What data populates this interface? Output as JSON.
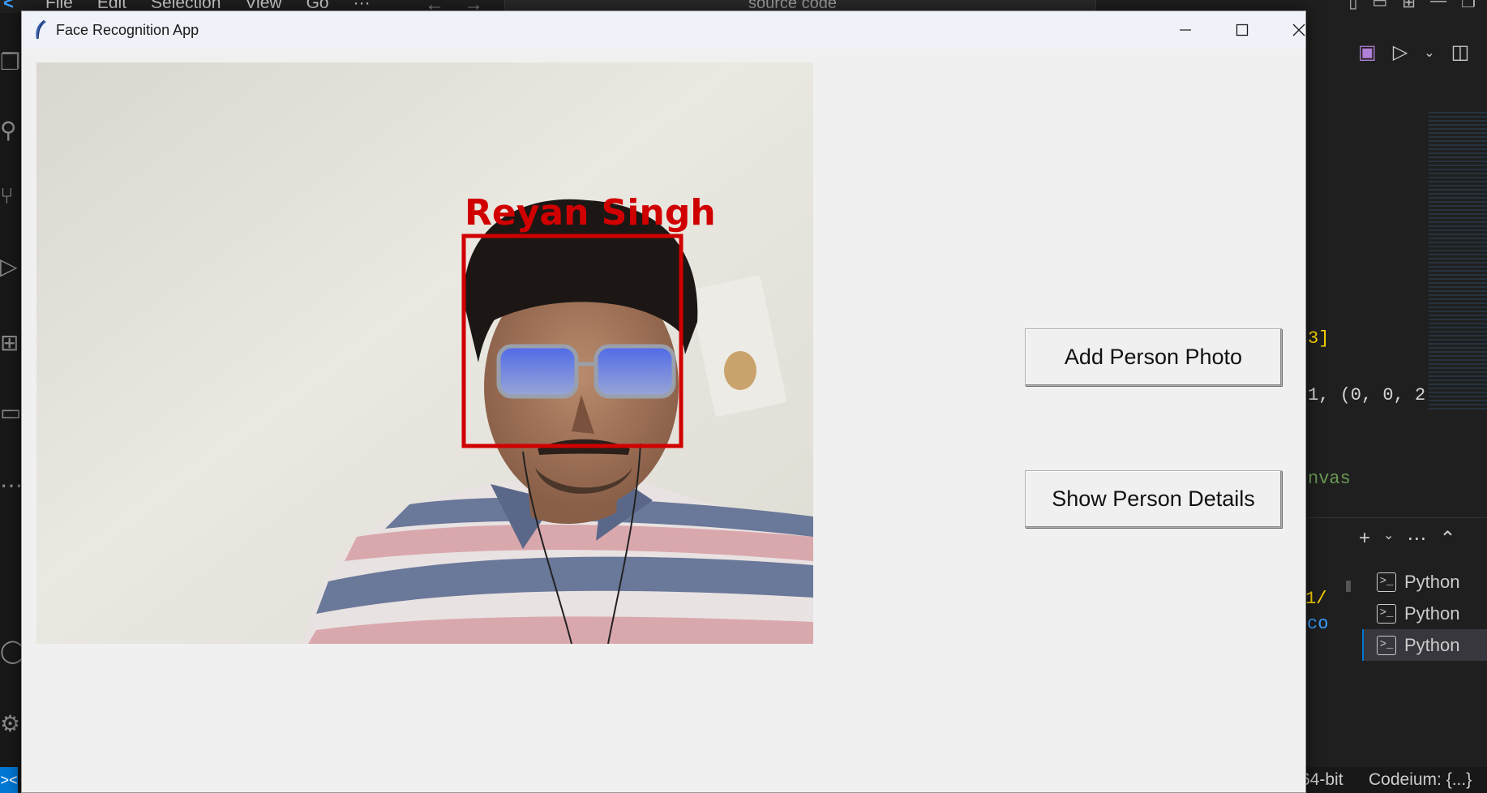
{
  "app": {
    "title": "Face Recognition App",
    "window_controls": [
      "minimize",
      "maximize",
      "close"
    ]
  },
  "video_feed": {
    "detected_name": "Reyan Singh",
    "box_color": "#d10000"
  },
  "buttons": {
    "add_person": "Add Person Photo",
    "show_details": "Show Person Details"
  },
  "background_editor": {
    "menu": [
      "File",
      "Edit",
      "Selection",
      "View",
      "Go",
      "···"
    ],
    "search_placeholder": "source code",
    "code_fragments": [
      "3]",
      "1, (0, 0, 2",
      "nvas",
      "1/",
      "co"
    ],
    "terminals": [
      "Python",
      "Python",
      "Python"
    ],
    "status": {
      "interpreter": "64-bit",
      "extension": "Codeium: {...}"
    },
    "accent": "#0078d4"
  }
}
